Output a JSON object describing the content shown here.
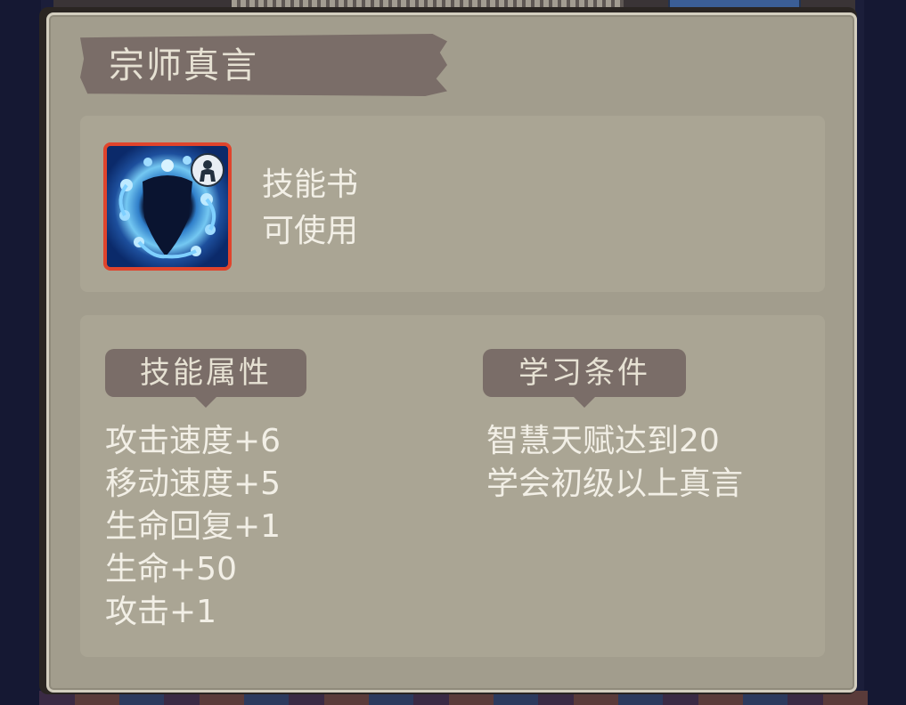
{
  "tooltip": {
    "title": "宗师真言",
    "item_type": "技能书",
    "usable": "可使用",
    "icon": "shield-spirit-skill-icon",
    "badge_icon": "figure-badge-icon"
  },
  "attributes": {
    "header": "技能属性",
    "items": [
      "攻击速度+6",
      "移动速度+5",
      "生命回复+1",
      "生命+50",
      "攻击+1"
    ]
  },
  "requirements": {
    "header": "学习条件",
    "items": [
      "智慧天赋达到20",
      "学会初级以上真言"
    ]
  },
  "colors": {
    "panel": "#a29d8d",
    "section": "#aaa594",
    "ribbon": "#7a6d68",
    "text": "#f2efe6",
    "icon_border": "#e0442c"
  }
}
